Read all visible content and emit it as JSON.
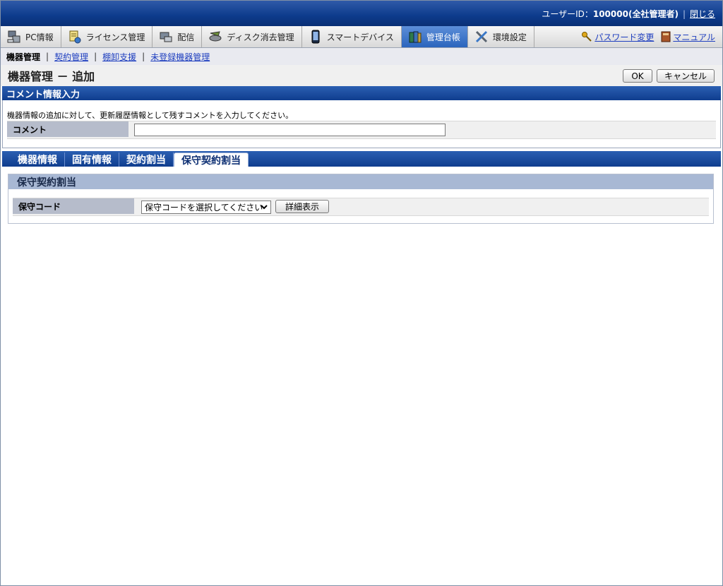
{
  "header": {
    "user_label": "ユーザーID：",
    "user_value": "100000(全社管理者)",
    "close_link": "閉じる"
  },
  "nav": {
    "items": [
      {
        "label": "PC情報",
        "icon": "pc-icon"
      },
      {
        "label": "ライセンス管理",
        "icon": "license-icon"
      },
      {
        "label": "配信",
        "icon": "delivery-icon"
      },
      {
        "label": "ディスク消去管理",
        "icon": "disk-erase-icon"
      },
      {
        "label": "スマートデバイス",
        "icon": "smart-device-icon"
      },
      {
        "label": "管理台帳",
        "icon": "ledger-icon",
        "active": true
      },
      {
        "label": "環境設定",
        "icon": "settings-tools-icon"
      }
    ],
    "password_link": "パスワード変更",
    "manual_link": "マニュアル"
  },
  "subnav": {
    "current": "機器管理",
    "links": [
      "契約管理",
      "棚卸支援",
      "未登録機器管理"
    ]
  },
  "page": {
    "title": "機器管理 － 追加",
    "ok_label": "OK",
    "cancel_label": "キャンセル"
  },
  "comment_section": {
    "header": "コメント情報入力",
    "description": "機器情報の追加に対して、更新履歴情報として残すコメントを入力してください。",
    "label": "コメント",
    "value": ""
  },
  "tabs": [
    "機器情報",
    "固有情報",
    "契約割当",
    "保守契約割当"
  ],
  "active_tab": "保守契約割当",
  "maintenance": {
    "header": "保守契約割当",
    "code_label": "保守コード",
    "select_value": "保守コードを選択してください",
    "detail_button": "詳細表示"
  },
  "colors": {
    "header_blue": "#0d3b8c",
    "active_tab": "#2b65bd",
    "link": "#1f3fbf"
  }
}
